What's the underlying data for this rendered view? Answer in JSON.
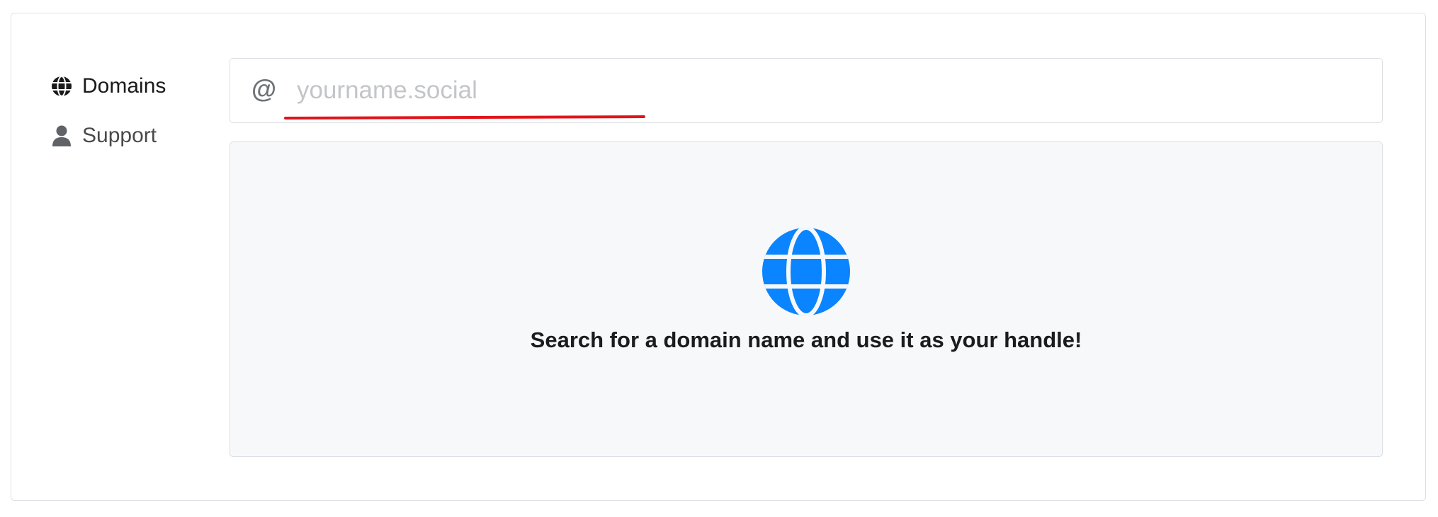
{
  "sidebar": {
    "items": [
      {
        "label": "Domains",
        "icon": "globe-icon",
        "active": true
      },
      {
        "label": "Support",
        "icon": "user-icon",
        "active": false
      }
    ]
  },
  "search": {
    "prefix": "@",
    "placeholder": "yourname.social",
    "value": ""
  },
  "empty_state": {
    "icon": "globe-icon",
    "message": "Search for a domain name and use it as your handle!"
  },
  "colors": {
    "accent_blue": "#0a84ff",
    "annotation_red": "#e0151b"
  }
}
